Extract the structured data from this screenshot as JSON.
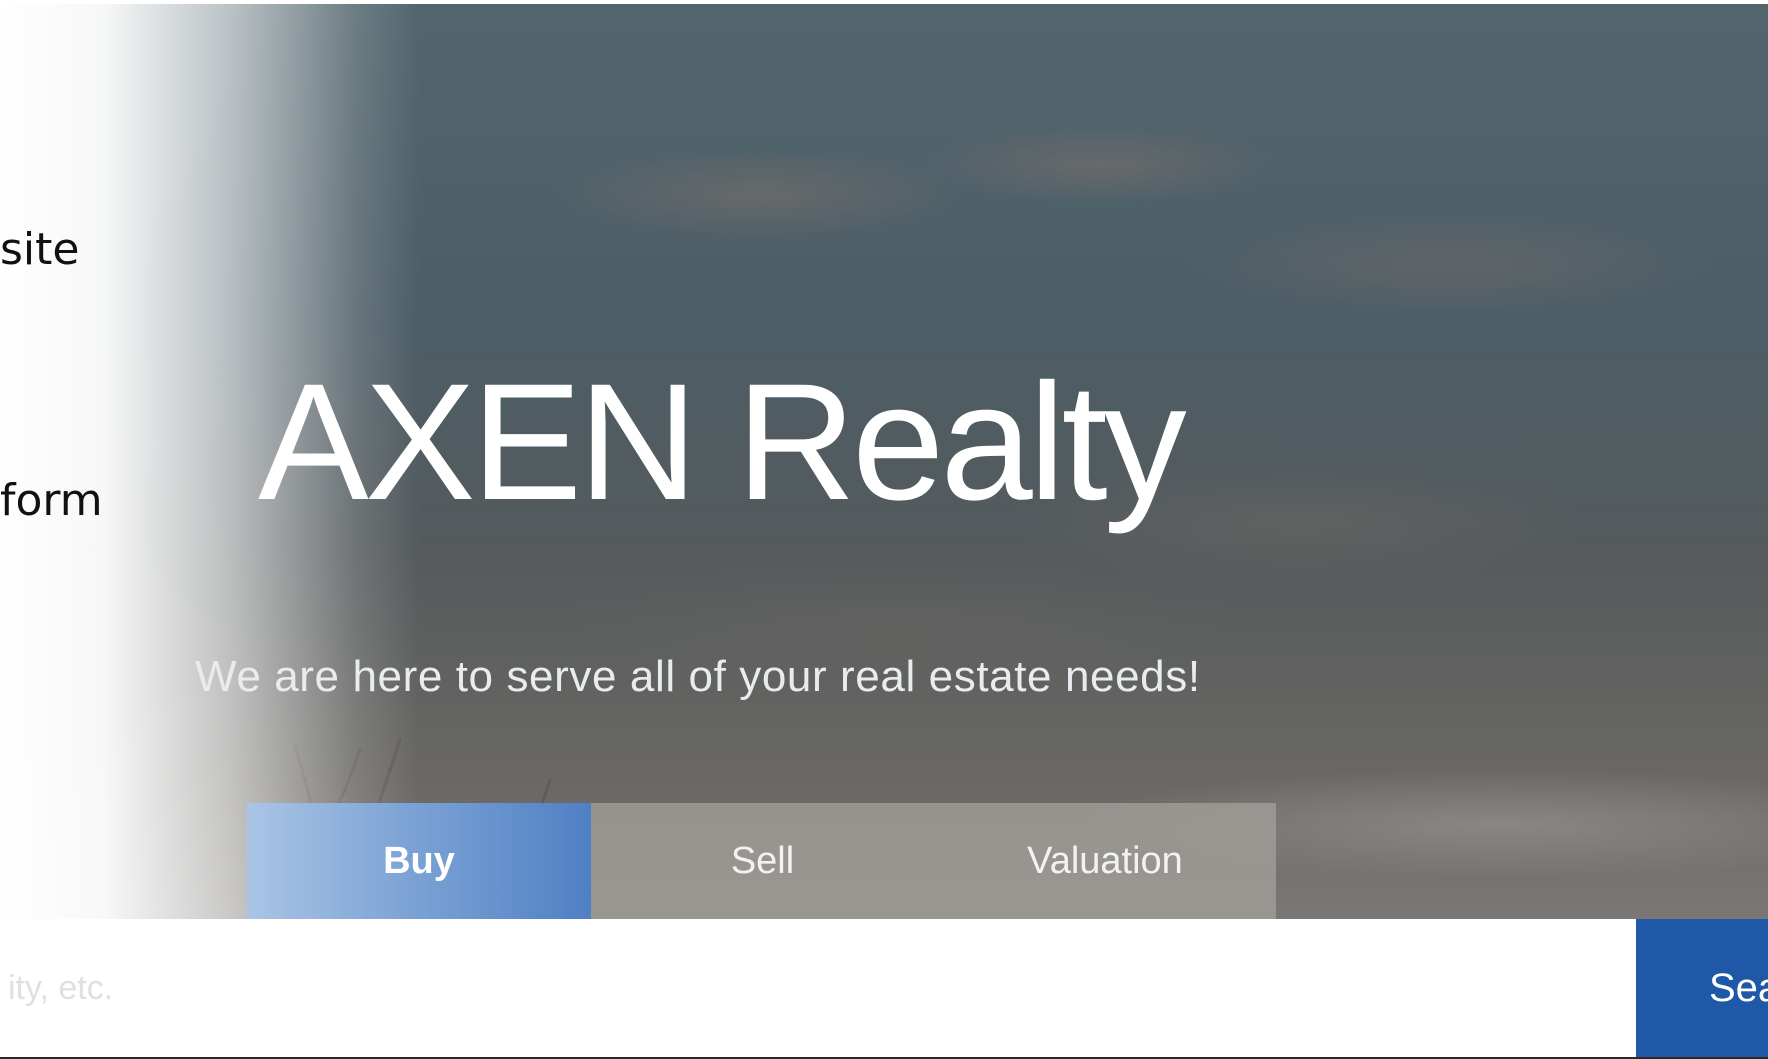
{
  "side_text": {
    "line_1": "site",
    "line_2": "form"
  },
  "hero": {
    "title": "AXEN Realty",
    "subtitle": "We are here to serve all of your real estate needs!"
  },
  "tabs": [
    {
      "label": "Buy",
      "active": true
    },
    {
      "label": "Sell",
      "active": false
    },
    {
      "label": "Valuation",
      "active": false
    }
  ],
  "search": {
    "placeholder": "ity, etc.",
    "value": "",
    "button_label": "Sea"
  },
  "colors": {
    "accent": "#1f58a6",
    "active_tab": "#4f80c4",
    "inactive_tab": "#a09d99"
  }
}
